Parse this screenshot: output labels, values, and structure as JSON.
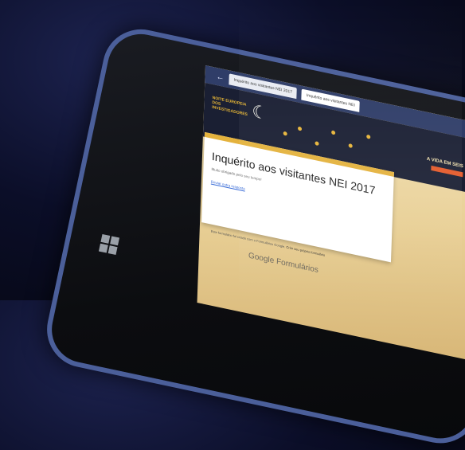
{
  "browser": {
    "tab_1": "Inquérito aos visitantes NEI 2017",
    "tab_2": "Inquérito aos visitantes NEI"
  },
  "banner": {
    "left_text": "NOITE EUROPEIA DOS INVESTIGADORES",
    "right_text": "A VIDA EM SEIS"
  },
  "form": {
    "title": "Inquérito aos visitantes NEI 2017",
    "subtitle": "Muito obrigado pelo seu tempo!",
    "submit_another": "Enviar outra resposta"
  },
  "footer": {
    "note": "Este formulário foi criado com o Formulários Google.",
    "link": "Criar seu próprio formulário",
    "brand": "Google Formulários"
  }
}
